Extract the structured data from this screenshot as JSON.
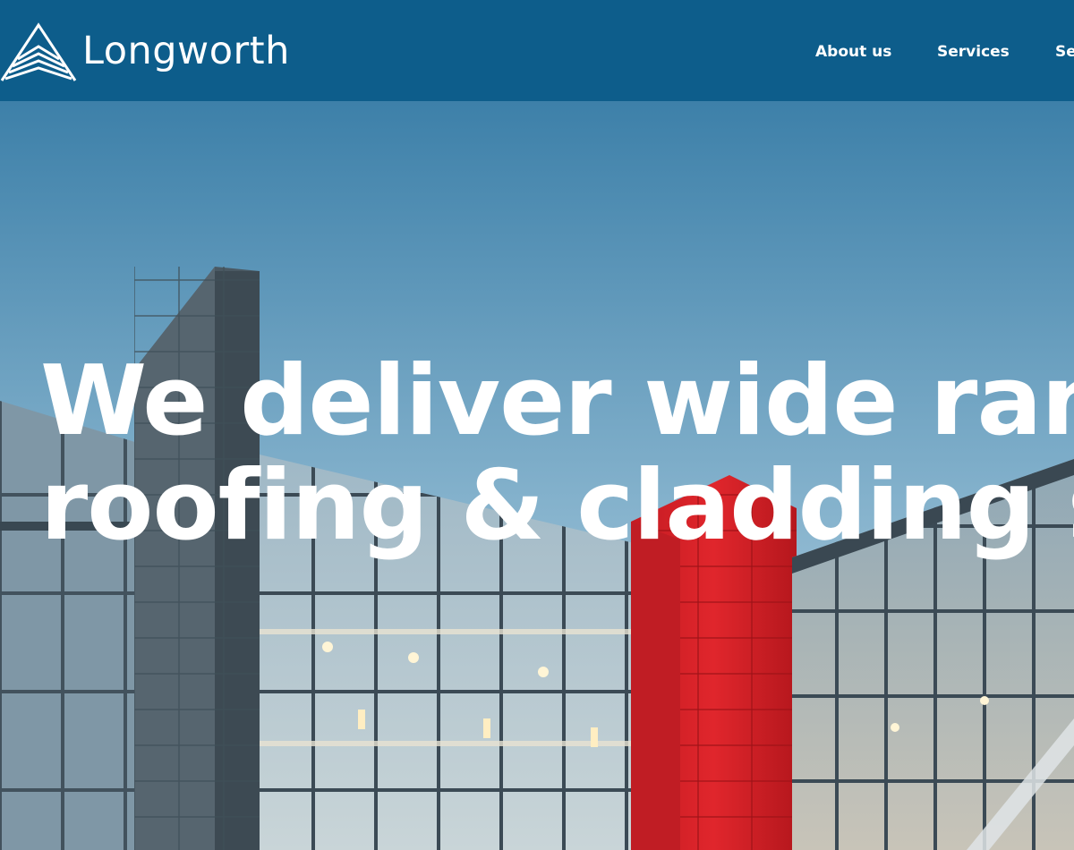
{
  "brand": {
    "name": "Longworth",
    "logo_icon": "triangle-chevron-logo"
  },
  "nav": {
    "items": [
      {
        "label": "About us"
      },
      {
        "label": "Services"
      },
      {
        "label": "Se"
      }
    ]
  },
  "hero": {
    "headline_line1": "We deliver wide ran",
    "headline_line2": "roofing & cladding s",
    "image": "glass-office-building-with-red-cladding"
  },
  "colors": {
    "header_bg": "#0d5d8b",
    "sky_top": "#3c7fa8",
    "sky_bottom": "#b9d3e1",
    "accent_red": "#d8242a",
    "text": "#ffffff"
  }
}
